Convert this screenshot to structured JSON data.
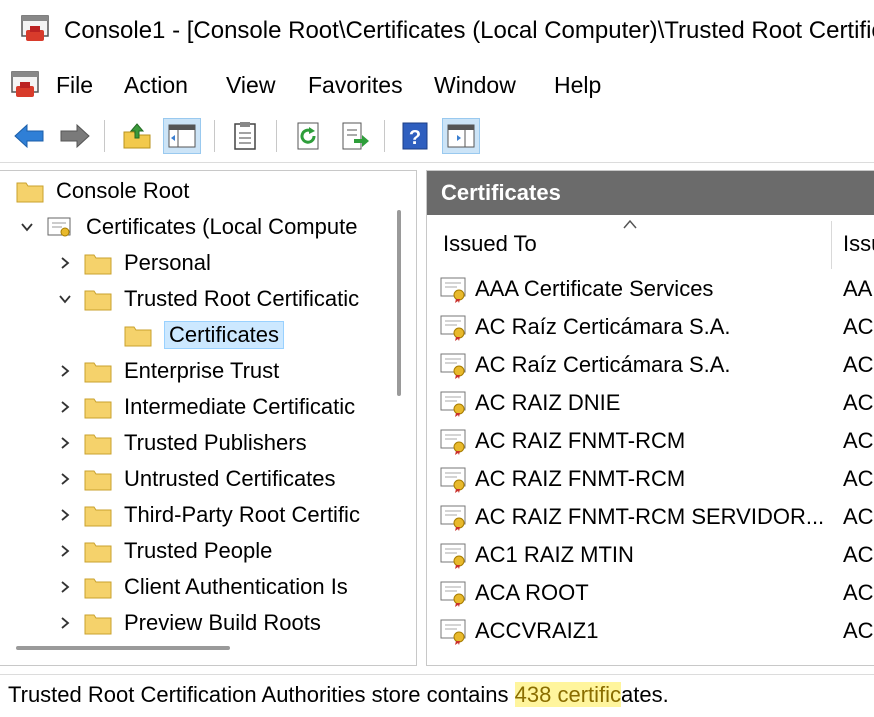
{
  "window": {
    "title": "Console1 - [Console Root\\Certificates (Local Computer)\\Trusted Root Certific"
  },
  "menu": [
    "File",
    "Action",
    "View",
    "Favorites",
    "Window",
    "Help"
  ],
  "toolbar_icons": [
    "back-icon",
    "forward-icon",
    "up-folder-icon",
    "show-hide-tree-icon",
    "properties-icon",
    "refresh-icon",
    "export-list-icon",
    "help-icon",
    "show-action-pane-icon"
  ],
  "tree": {
    "root": "Console Root",
    "store": "Certificates (Local Compute",
    "items": [
      {
        "label": "Personal",
        "expanded": false
      },
      {
        "label": "Trusted Root Certificatic",
        "expanded": true,
        "child": "Certificates"
      },
      {
        "label": "Enterprise Trust",
        "expanded": false
      },
      {
        "label": "Intermediate Certificatic",
        "expanded": false
      },
      {
        "label": "Trusted Publishers",
        "expanded": false
      },
      {
        "label": "Untrusted Certificates",
        "expanded": false
      },
      {
        "label": "Third-Party Root Certific",
        "expanded": false
      },
      {
        "label": "Trusted People",
        "expanded": false
      },
      {
        "label": "Client Authentication Is",
        "expanded": false
      },
      {
        "label": "Preview Build Roots",
        "expanded": false
      }
    ]
  },
  "list": {
    "header": "Certificates",
    "columns": [
      "Issued To",
      "Issu"
    ],
    "rows": [
      {
        "issued_to": "AAA Certificate Services",
        "issued_by": "AA"
      },
      {
        "issued_to": "AC Raíz Certicámara S.A.",
        "issued_by": "AC"
      },
      {
        "issued_to": "AC Raíz Certicámara S.A.",
        "issued_by": "AC"
      },
      {
        "issued_to": "AC RAIZ DNIE",
        "issued_by": "AC"
      },
      {
        "issued_to": "AC RAIZ FNMT-RCM",
        "issued_by": "AC"
      },
      {
        "issued_to": "AC RAIZ FNMT-RCM",
        "issued_by": "AC"
      },
      {
        "issued_to": "AC RAIZ FNMT-RCM SERVIDOR...",
        "issued_by": "AC"
      },
      {
        "issued_to": "AC1 RAIZ MTIN",
        "issued_by": "AC"
      },
      {
        "issued_to": "ACA ROOT",
        "issued_by": "AC"
      },
      {
        "issued_to": "ACCVRAIZ1",
        "issued_by": "AC"
      }
    ]
  },
  "status": {
    "prefix": "Trusted Root Certification Authorities store contains ",
    "highlight": "438 certific",
    "suffix": "ates."
  },
  "colors": {
    "header_bg": "#6b6b6b",
    "selection_bg": "#cce8ff",
    "highlight_bg": "#fff59d"
  }
}
